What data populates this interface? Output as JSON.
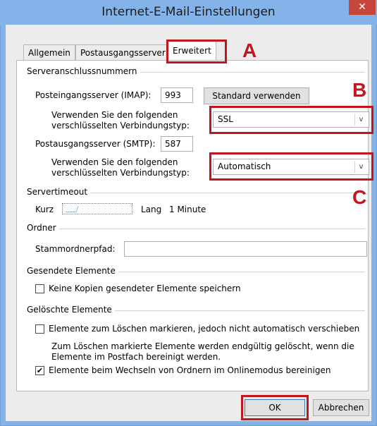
{
  "window": {
    "title": "Internet-E-Mail-Einstellungen",
    "close_glyph": "✕"
  },
  "tabs": [
    {
      "label": "Allgemein"
    },
    {
      "label": "Postausgangsserver"
    },
    {
      "label": "Erweitert"
    }
  ],
  "server_ports": {
    "group_label": "Serveranschlussnummern",
    "imap_label": "Posteingangsserver (IMAP):",
    "imap_value": "993",
    "default_button": "Standard verwenden",
    "imap_encryption_label_1": "Verwenden Sie den folgenden",
    "imap_encryption_label_2": "verschlüsselten Verbindungstyp:",
    "imap_encryption_value": "SSL",
    "smtp_label": "Postausgangsserver (SMTP):",
    "smtp_value": "587",
    "smtp_encryption_label_1": "Verwenden Sie den folgenden",
    "smtp_encryption_label_2": "verschlüsselten Verbindungstyp:",
    "smtp_encryption_value": "Automatisch"
  },
  "timeout": {
    "group_label": "Servertimeout",
    "short_label": "Kurz",
    "long_label": "Lang",
    "value": "1 Minute"
  },
  "folders": {
    "group_label": "Ordner",
    "root_path_label": "Stammordnerpfad:",
    "root_path_value": ""
  },
  "sent_items": {
    "group_label": "Gesendete Elemente",
    "no_copies_label": "Keine Kopien gesendeter Elemente speichern",
    "no_copies_checked": false
  },
  "deleted_items": {
    "group_label": "Gelöschte Elemente",
    "mark_label": "Elemente zum Löschen markieren, jedoch nicht automatisch verschieben",
    "mark_checked": false,
    "note_1": "Zum Löschen markierte Elemente werden endgültig gelöscht, wenn die",
    "note_2": "Elemente im Postfach bereinigt werden.",
    "purge_label": "Elemente beim Wechseln von Ordnern im Onlinemodus bereinigen",
    "purge_checked": true
  },
  "buttons": {
    "ok": "OK",
    "cancel": "Abbrechen"
  },
  "annotations": {
    "a": "A",
    "b": "B",
    "c": "C"
  },
  "icons": {
    "dropdown": "chevron-down-icon",
    "check": "✔",
    "arrow_glyph": "v"
  }
}
